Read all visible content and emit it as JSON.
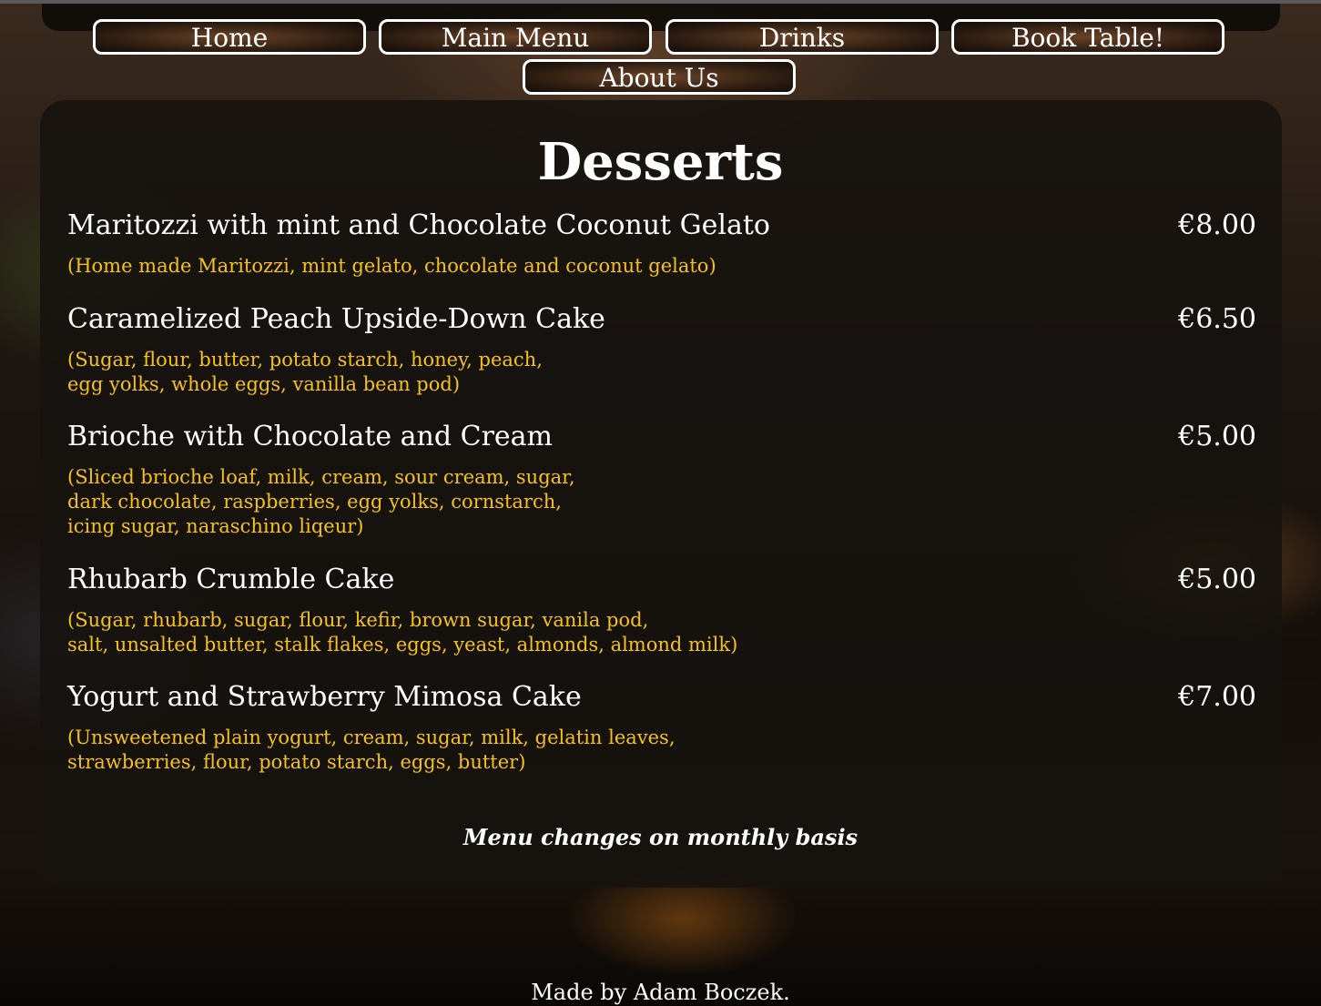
{
  "nav": {
    "home": "Home",
    "main_menu": "Main Menu",
    "drinks": "Drinks",
    "book_table": "Book Table!",
    "about_us": "About Us"
  },
  "section": {
    "title": "Desserts"
  },
  "items": [
    {
      "name": "Maritozzi with mint and Chocolate Coconut Gelato",
      "price": "€8.00",
      "description": "(Home made Maritozzi, mint gelato, chocolate and coconut gelato)"
    },
    {
      "name": "Caramelized Peach Upside-Down Cake",
      "price": "€6.50",
      "description": "(Sugar, flour, butter, potato starch, honey, peach,\negg yolks, whole eggs, vanilla bean pod)"
    },
    {
      "name": "Brioche with Chocolate and Cream",
      "price": "€5.00",
      "description": "(Sliced brioche loaf, milk, cream, sour cream, sugar,\ndark chocolate, raspberries, egg yolks, cornstarch,\nicing sugar, naraschino liqeur)"
    },
    {
      "name": "Rhubarb Crumble Cake",
      "price": "€5.00",
      "description": "(Sugar, rhubarb, sugar, flour, kefir, brown sugar, vanila pod,\nsalt, unsalted butter, stalk flakes, eggs, yeast, almonds, almond milk)"
    },
    {
      "name": "Yogurt and Strawberry Mimosa Cake",
      "price": "€7.00",
      "description": "(Unsweetened plain yogurt, cream, sugar, milk, gelatin leaves,\nstrawberries, flour, potato starch, eggs, butter)"
    }
  ],
  "note": "Menu changes on monthly basis",
  "footer": "Made by Adam Boczek.",
  "colors": {
    "text": "#ffffff",
    "description": "#f6c21a",
    "panel": "#16120f",
    "button_border": "#ffffff"
  }
}
